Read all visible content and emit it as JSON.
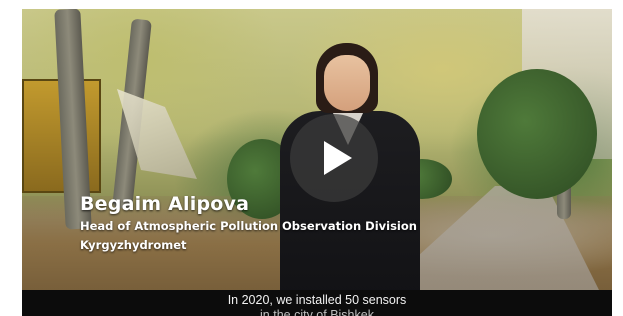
{
  "video": {
    "speaker_name": "Begaim Alipova",
    "speaker_title": "Head of Atmospheric Pollution Observation Division",
    "speaker_org": "Kyrgyzhydromet",
    "subtitle_line_1": "In 2020, we installed 50 sensors",
    "subtitle_line_2": "in the city of Bishkek",
    "play_icon": "play-icon"
  },
  "colors": {
    "overlay_text": "#ffffff",
    "subtitle_bar": "#0c0c0c",
    "play_button_bg": "#3c3c3c"
  }
}
